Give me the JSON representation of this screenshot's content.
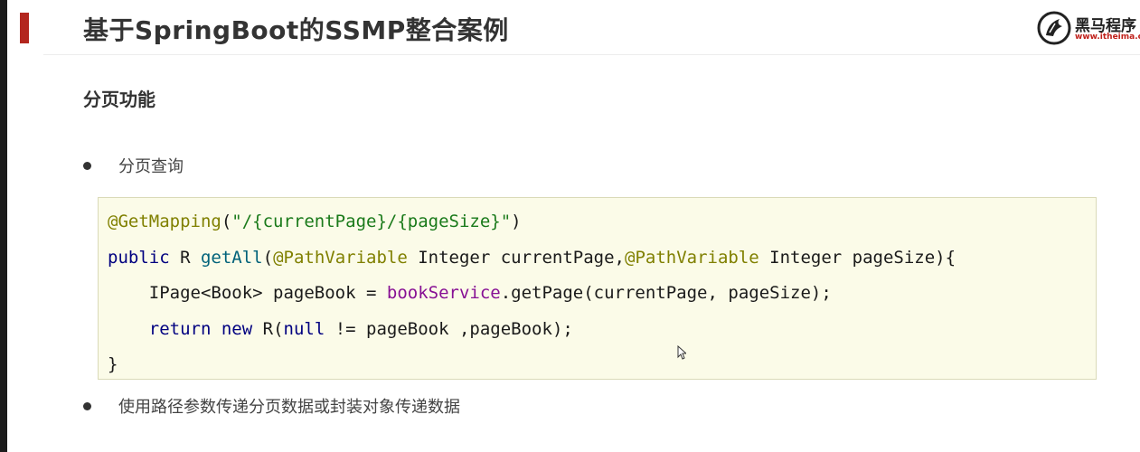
{
  "header": {
    "title": "基于SpringBoot的SSMP整合案例",
    "logo": {
      "name": "黑马程序",
      "url": "www.itheima.c"
    }
  },
  "section": {
    "heading": "分页功能"
  },
  "bullets": [
    "分页查询",
    "使用路径参数传递分页数据或封装对象传递数据"
  ],
  "code": {
    "line1": {
      "annotation": "@GetMapping",
      "open": "(",
      "string": "\"/{currentPage}/{pageSize}\"",
      "close": ")"
    },
    "line2": {
      "kw_public": "public",
      "ret": " R ",
      "method": "getAll",
      "paren": "(",
      "ann1": "@PathVariable",
      "param1": " Integer currentPage,",
      "ann2": "@PathVariable",
      "param2": " Integer pageSize){"
    },
    "line3": {
      "indent": "    ",
      "decl": "IPage<Book> pageBook = ",
      "field": "bookService",
      "call": ".getPage(currentPage, pageSize);"
    },
    "line4": {
      "indent": "    ",
      "kw_return": "return",
      "sp1": " ",
      "kw_new": "new",
      "mid": " R(",
      "kw_null": "null",
      "tail": " != pageBook ,pageBook);"
    },
    "line5": {
      "brace": "}"
    }
  },
  "colors": {
    "accent": "#b3261e",
    "annotation": "#808000",
    "string": "#1a7a1a",
    "keyword": "#000080",
    "method": "#00627a",
    "field": "#871094",
    "code_background": "#fbfbe8"
  },
  "icons": [
    "horse-logo-icon",
    "mouse-cursor-icon"
  ]
}
